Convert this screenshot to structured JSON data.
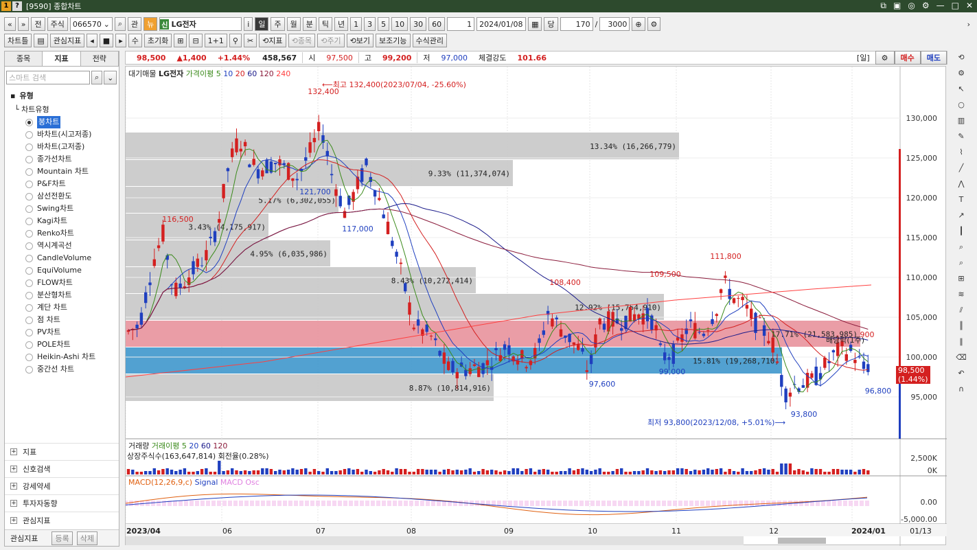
{
  "window": {
    "title": "[9590] 종합차트",
    "icons": [
      "1",
      "?"
    ]
  },
  "toolbar1": {
    "nav_prev": "«",
    "nav_up": "»",
    "btn_jeon": "전",
    "market": "주식",
    "code": "066570",
    "btn_gwan": "관",
    "btn_nyu": "뉴",
    "stock_tag": "신",
    "stock_name": "LG전자",
    "btn_i": "i",
    "periods": [
      "일",
      "주",
      "월",
      "분",
      "틱",
      "년"
    ],
    "intervals": [
      "1",
      "3",
      "5",
      "10",
      "30",
      "60"
    ],
    "count_input": "1",
    "date": "2024/01/08",
    "btn_dang": "당",
    "view_count": "170",
    "total_count": "3000"
  },
  "toolbar2": {
    "items": [
      "차트틀",
      "관심지표",
      "수",
      "초기화",
      "1+1",
      "⟲지표",
      "⟲종목",
      "⟲주기",
      "⟲보기",
      "보조기능",
      "수식관리"
    ]
  },
  "left_panel": {
    "tabs": [
      "종목",
      "지표",
      "전략"
    ],
    "active_tab": "지표",
    "search_placeholder": "스마트 검색",
    "group": "유형",
    "subgroup": "차트유형",
    "chart_types": [
      "봉차트",
      "바차트(시고저종)",
      "바차트(고저종)",
      "종가선차트",
      "Mountain 차트",
      "P&F차트",
      "삼선전환도",
      "Swing차트",
      "Kagi차트",
      "Renko차트",
      "역시계곡선",
      "CandleVolume",
      "EquiVolume",
      "FLOW차트",
      "분산형차트",
      "계단 차트",
      "점 차트",
      "PV차트",
      "POLE차트",
      "Heikin-Ashi 차트",
      "중간선 차트"
    ],
    "selected_type": "봉차트",
    "bottom_groups": [
      "지표",
      "신호검색",
      "강세약세",
      "투자자동향",
      "관심지표"
    ],
    "footer": {
      "label": "관심지표",
      "register": "등록",
      "delete": "삭제"
    }
  },
  "infobar": {
    "price": "98,500",
    "change": "▲1,400",
    "change_pct": "+1.44%",
    "volume": "458,567",
    "open_label": "시",
    "open": "97,500",
    "high_label": "고",
    "high": "99,200",
    "low_label": "저",
    "low": "97,000",
    "strength_label": "체결강도",
    "strength": "101.66",
    "period_tag": "[일]",
    "buy": "매수",
    "sell": "매도"
  },
  "chart": {
    "legend": [
      "대기매물",
      "LG전자",
      "가격이평 5",
      "10",
      "20",
      "60",
      "120",
      "240"
    ],
    "annotations": {
      "high_note": "⟵최고 132,400(2023/07/04, -25.60%)",
      "low_note": "최저 93,800(2023/12/08, +5.01%)⟶",
      "dividend": "배당락(1주)",
      "current_price": "98,500",
      "current_pct": "(1.44%)"
    },
    "price_labels": [
      {
        "text": "132,400",
        "color": "red"
      },
      {
        "text": "116,500",
        "color": "red"
      },
      {
        "text": "121,700",
        "color": "blue"
      },
      {
        "text": "117,000",
        "color": "blue"
      },
      {
        "text": "108,400",
        "color": "red"
      },
      {
        "text": "109,500",
        "color": "red"
      },
      {
        "text": "111,800",
        "color": "red"
      },
      {
        "text": "97,600",
        "color": "blue"
      },
      {
        "text": "99,000",
        "color": "blue"
      },
      {
        "text": "93,800",
        "color": "blue"
      },
      {
        "text": "96,800",
        "color": "blue"
      },
      {
        "text": "900",
        "color": "red"
      }
    ],
    "volume_profile": [
      {
        "label": "13.34% (16,266,779)"
      },
      {
        "label": "9.33% (11,374,074)"
      },
      {
        "label": "5.17% (6,302,055)"
      },
      {
        "label": "3.43% (4,175,917)"
      },
      {
        "label": "4.95% (6,035,986)"
      },
      {
        "label": "8.43% (10,272,414)"
      },
      {
        "label": "12.92% (15,754,910)"
      },
      {
        "label": "17.71% (21,583,985)"
      },
      {
        "label": "15.81% (19,268,710)"
      },
      {
        "label": "8.87% (10,814,916)"
      }
    ],
    "y_ticks": [
      "130,000",
      "125,000",
      "120,000",
      "115,000",
      "110,000",
      "105,000",
      "100,000",
      "95,000"
    ],
    "x_ticks": [
      "2023/04",
      "06",
      "07",
      "08",
      "09",
      "10",
      "11",
      "12",
      "2024/01",
      "01/13"
    ],
    "volume_legend": [
      "거래량",
      "거래이평 5",
      "20",
      "60",
      "120"
    ],
    "volume_info": "상장주식수(163,647,814) 회전율(0.28%)",
    "volume_ticks": [
      "2,500K",
      "0K"
    ],
    "macd_legend": [
      "MACD(12,26,9,c)",
      "Signal",
      "MACD Osc"
    ],
    "macd_ticks": [
      "0.00",
      "-5,000.00"
    ]
  },
  "colors": {
    "up": "#d42020",
    "down": "#1f3fbf",
    "ma5": "#3a8a1a",
    "ma10": "#1f3fbf",
    "ma20": "#d42020",
    "ma60": "#1a1a8a",
    "ma120": "#8a1a3a",
    "ma240": "#ff4040"
  }
}
